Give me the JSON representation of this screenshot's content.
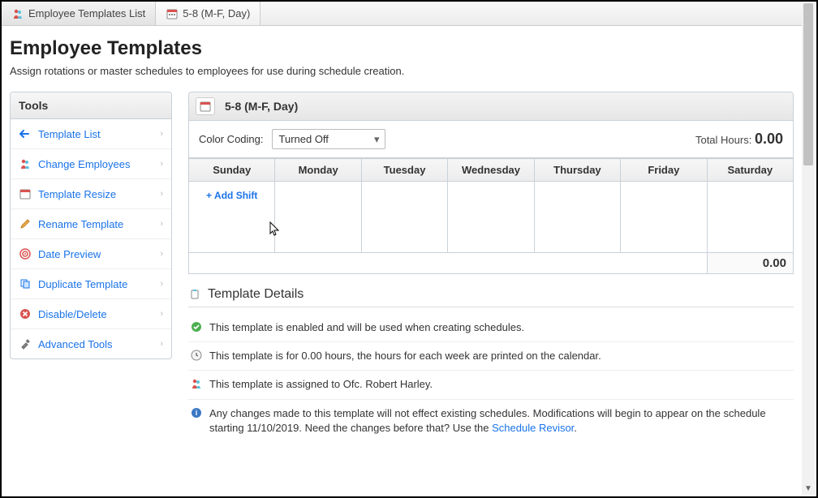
{
  "tabs": {
    "list": "Employee Templates List",
    "current": "5-8 (M-F, Day)"
  },
  "page": {
    "title": "Employee Templates",
    "subtitle": "Assign rotations or master schedules to employees for use during schedule creation."
  },
  "tools": {
    "header": "Tools",
    "items": [
      {
        "label": "Template List"
      },
      {
        "label": "Change Employees"
      },
      {
        "label": "Template Resize"
      },
      {
        "label": "Rename Template"
      },
      {
        "label": "Date Preview"
      },
      {
        "label": "Duplicate Template"
      },
      {
        "label": "Disable/Delete"
      },
      {
        "label": "Advanced Tools"
      }
    ]
  },
  "template": {
    "name": "5-8 (M-F, Day)",
    "color_coding_label": "Color Coding:",
    "color_coding_value": "Turned Off",
    "total_hours_label": "Total Hours: ",
    "total_hours": "0.00",
    "days": [
      "Sunday",
      "Monday",
      "Tuesday",
      "Wednesday",
      "Thursday",
      "Friday",
      "Saturday"
    ],
    "add_shift": "Add Shift",
    "footer_total": "0.00"
  },
  "details": {
    "header": "Template Details",
    "enabled": "This template is enabled and will be used when creating schedules.",
    "hours": "This template is for 0.00 hours, the hours for each week are printed on the calendar.",
    "assigned": "This template is assigned to Ofc. Robert Harley.",
    "changes_before": "Any changes made to this template will not effect existing schedules. Modifications will begin to appear on the schedule starting 11/10/2019. Need the changes before that? Use the ",
    "revisor_link": "Schedule Revisor",
    "changes_after": "."
  }
}
